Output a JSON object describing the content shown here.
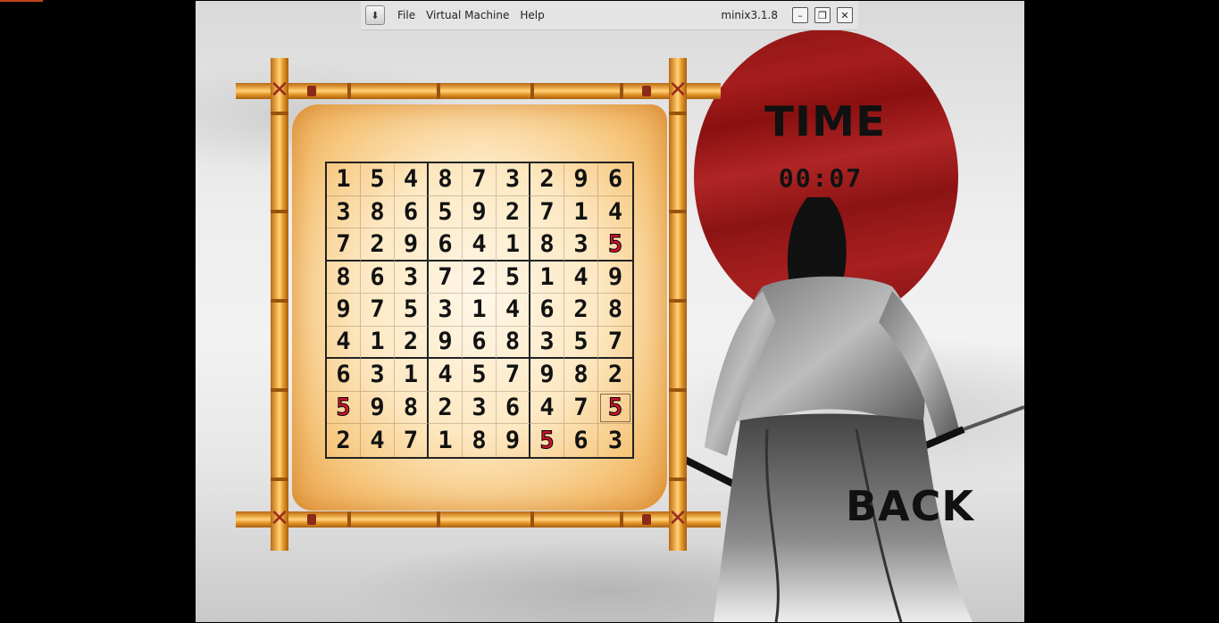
{
  "vm_menubar": {
    "menus": [
      "File",
      "Virtual Machine",
      "Help"
    ],
    "vm_name": "minix3.1.8",
    "pin_icon": "pin-icon",
    "window_buttons": [
      "minimize-icon",
      "restore-icon",
      "close-icon"
    ]
  },
  "game": {
    "time_label": "TIME",
    "timer": "00:07",
    "back_label": "BACK",
    "highlight_color": "#d01430",
    "sun_color": "#9b1a1a",
    "board": [
      [
        "1",
        "5",
        "4",
        "8",
        "7",
        "3",
        "2",
        "9",
        "6"
      ],
      [
        "3",
        "8",
        "6",
        "5",
        "9",
        "2",
        "7",
        "1",
        "4"
      ],
      [
        "7",
        "2",
        "9",
        "6",
        "4",
        "1",
        "8",
        "3",
        "5"
      ],
      [
        "8",
        "6",
        "3",
        "7",
        "2",
        "5",
        "1",
        "4",
        "9"
      ],
      [
        "9",
        "7",
        "5",
        "3",
        "1",
        "4",
        "6",
        "2",
        "8"
      ],
      [
        "4",
        "1",
        "2",
        "9",
        "6",
        "8",
        "3",
        "5",
        "7"
      ],
      [
        "6",
        "3",
        "1",
        "4",
        "5",
        "7",
        "9",
        "8",
        "2"
      ],
      [
        "5",
        "9",
        "8",
        "2",
        "3",
        "6",
        "4",
        "7",
        "5"
      ],
      [
        "2",
        "4",
        "7",
        "1",
        "8",
        "9",
        "5",
        "6",
        "3"
      ]
    ],
    "highlighted_cells": [
      [
        2,
        8
      ],
      [
        7,
        0
      ],
      [
        7,
        8
      ],
      [
        8,
        6
      ]
    ],
    "selected_cell": [
      7,
      8
    ]
  }
}
